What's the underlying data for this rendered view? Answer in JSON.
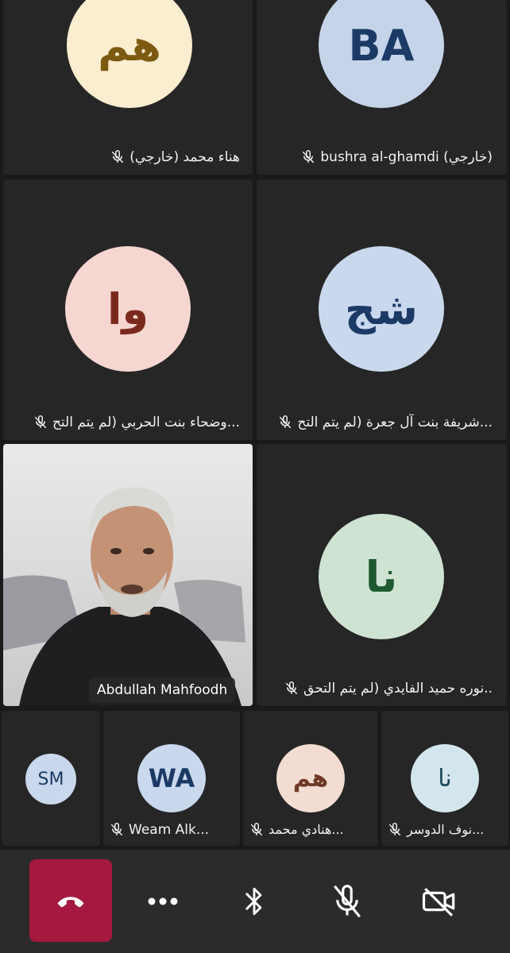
{
  "tiles": [
    {
      "initials": "هم",
      "name": "هناء محمد (خارجي)",
      "avatar_bg": "#fbeed0",
      "avatar_fg": "#7d5a12"
    },
    {
      "initials": "BA",
      "name": "bushra al-ghamdi (خارجي)",
      "avatar_bg": "#c6d4ea",
      "avatar_fg": "#1c3a66"
    },
    {
      "initials": "وا",
      "name": "وضحاء بنت الحربي (لم يتم التح...",
      "avatar_bg": "#f6d6d0",
      "avatar_fg": "#7a2a1c"
    },
    {
      "initials": "شج",
      "name": "شريفة بنت آل جعرة (لم يتم التح...",
      "avatar_bg": "#c9d8ed",
      "avatar_fg": "#1c3a66"
    },
    {
      "initials": "نا",
      "name": "نوره حميد الفايدي (لم يتم التحق..",
      "avatar_bg": "#cfe3d3",
      "avatar_fg": "#1d5a2f"
    }
  ],
  "video": {
    "name": "Abdullah Mahfoodh"
  },
  "small_tiles": [
    {
      "initials": "SM",
      "name": "",
      "avatar_bg": "#c9d8ed",
      "avatar_fg": "#1c3a66"
    },
    {
      "initials": "WA",
      "name": "Weam Alk...",
      "avatar_bg": "#c9d8ed",
      "avatar_fg": "#1c3a66"
    },
    {
      "initials": "هم",
      "name": "هنادي محمد...",
      "avatar_bg": "#f3ddd2",
      "avatar_fg": "#6e3a26"
    },
    {
      "initials": "نا",
      "name": "نوف الدوسر...",
      "avatar_bg": "#d4e6ed",
      "avatar_fg": "#1c4a5a"
    }
  ],
  "toolbar": {
    "end_icon": "hang-up-icon",
    "more_icon": "more-icon",
    "bluetooth_icon": "bluetooth-icon",
    "mic_icon": "mic-off-icon",
    "camera_icon": "camera-off-icon",
    "end_color": "#a4193d"
  }
}
